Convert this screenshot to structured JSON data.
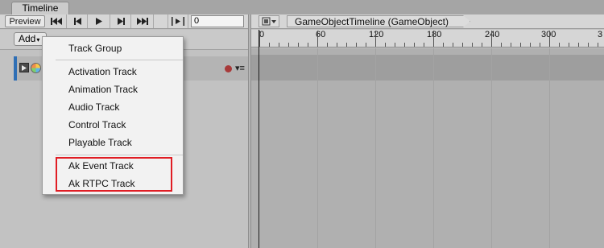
{
  "window": {
    "tab_label": "Timeline"
  },
  "toolbar": {
    "preview_label": "Preview",
    "buttons": [
      "go-to-start",
      "previous-frame",
      "play",
      "next-frame",
      "go-to-end",
      "play-range"
    ],
    "frame_value": "0"
  },
  "timeline_header": {
    "object_label": "GameObjectTimeline (GameObject)"
  },
  "add_row": {
    "add_label": "Add"
  },
  "ruler": {
    "ticks": [
      "0",
      "60",
      "120",
      "180",
      "240",
      "300",
      "3"
    ]
  },
  "menu": {
    "items": [
      "Track Group",
      "Activation Track",
      "Animation Track",
      "Audio Track",
      "Control Track",
      "Playable Track",
      "Ak Event Track",
      "Ak RTPC Track"
    ]
  },
  "colors": {
    "highlight": "#e01d24",
    "track_accent": "#2f6fb5",
    "record": "#a83a3a"
  }
}
